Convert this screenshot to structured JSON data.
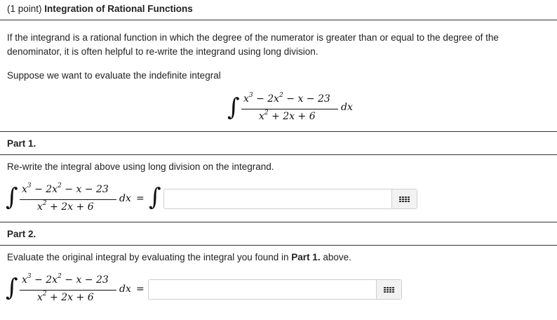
{
  "header": {
    "points": "(1 point)",
    "title": "Integration of Rational Functions"
  },
  "intro": {
    "line1": "If the integrand is a rational function in which the degree of the numerator is greater than or equal to the degree of the",
    "line2": "denominator, it is often helpful to re-write the integrand using long division.",
    "suppose": "Suppose we want to evaluate the indefinite integral"
  },
  "integral": {
    "numerator": "x³ − 2x² − x − 23",
    "denominator": "x² + 2x + 6",
    "dx": "dx"
  },
  "part1": {
    "heading": "Part 1.",
    "instruction": "Re-write the integral above using long division on the integrand.",
    "equals": "=",
    "answer_value": "",
    "answer_placeholder": ""
  },
  "part2": {
    "heading": "Part 2.",
    "instruction_prefix": "Evaluate the original integral by evaluating the integral you found in",
    "instruction_ref": "Part 1.",
    "instruction_suffix": "above.",
    "equals": "=",
    "answer_value": "",
    "answer_placeholder": ""
  },
  "icons": {
    "integral_symbol": "∫",
    "keyboard_icon": "keyboard-grid-icon"
  }
}
